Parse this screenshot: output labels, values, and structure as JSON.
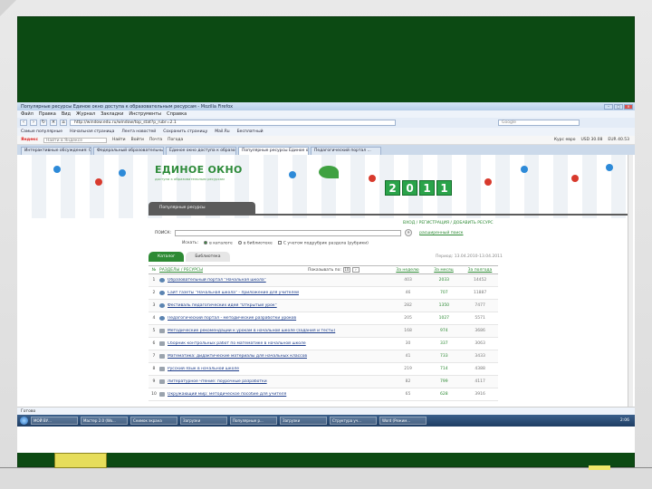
{
  "browser": {
    "title": "Популярные ресурсы Единое окно доступа к образовательным ресурсам - Mozilla Firefox",
    "menu": [
      "Файл",
      "Правка",
      "Вид",
      "Журнал",
      "Закладки",
      "Инструменты",
      "Справка"
    ],
    "url": "http://window.edu.ru/window/top_stat?p_rubr=2.1",
    "search_placeholder": "Google",
    "bookmarks": [
      "Самые популярные",
      "Начальная страница",
      "Лента новостей",
      "Сохранить страницу",
      "Mail.Ru",
      "Бесплатный"
    ],
    "toolbar": {
      "brand": "Яндекс",
      "input_placeholder": "Найти в Яндексе",
      "items": [
        "Найти",
        "Войти",
        "Почта",
        "Погода"
      ],
      "right": [
        "Курс евро",
        "USD 30.08",
        "EUR 40.53"
      ]
    },
    "tabs": [
      {
        "label": "Интерактивные обсуждения: Офи...",
        "active": false
      },
      {
        "label": "Федеральный образовательный...",
        "active": false
      },
      {
        "label": "Единое окно доступа к образоват...",
        "active": false
      },
      {
        "label": "Популярные ресурсы Единое окно...",
        "active": true
      },
      {
        "label": "Педагогический портал ...",
        "active": false
      }
    ],
    "status": "Готово"
  },
  "site": {
    "logo": "ЕДИНОЕ ОКНО",
    "logo_sub": "доступа к образовательным ресурсам",
    "year_digits": [
      "2",
      "0",
      "1",
      "1"
    ],
    "section_title": "Популярные ресурсы",
    "auth_links": "ВХОД / РЕГИСТРАЦИЯ / ДОБАВИТЬ РЕСУРС",
    "search_label": "ПОИСК:",
    "search_button": "»",
    "advanced_search": "расширенный поиск",
    "filters": [
      {
        "label": "Искать:",
        "type": "text"
      },
      {
        "label": "в каталоге",
        "type": "radio",
        "checked": true
      },
      {
        "label": "в библиотеке",
        "type": "radio",
        "checked": false
      },
      {
        "label": "С учетом подрубрик раздела (рубрики)",
        "type": "checkbox",
        "checked": false
      }
    ],
    "subtabs": [
      {
        "label": "Каталог",
        "active": true
      },
      {
        "label": "Библиотека",
        "active": false
      }
    ],
    "date_range": "Период: 13.04.2010-13.04.2011"
  },
  "table": {
    "headers": {
      "num": "№",
      "title": "РАЗДЕЛЫ / РЕСУРСЫ",
      "per_page": "Показывать по:",
      "per_page_value": "10",
      "col1": "За неделю",
      "col2": "За месяц",
      "col3": "За полгода"
    },
    "rows": [
      {
        "num": "1",
        "icon": "globe",
        "title": "Образовательный портал \"Начальная школа\"",
        "v1": "403",
        "v2": "2033",
        "v3": "14452"
      },
      {
        "num": "2",
        "icon": "globe",
        "title": "Сайт газеты \"Начальная школа\" - приложение для учителей",
        "v1": "46",
        "v2": "707",
        "v3": "11887"
      },
      {
        "num": "3",
        "icon": "globe",
        "title": "Фестиваль педагогических идей \"Открытый урок\"",
        "v1": "282",
        "v2": "1350",
        "v3": "7477"
      },
      {
        "num": "4",
        "icon": "globe",
        "title": "Педагогический портал - методические разработки уроков",
        "v1": "205",
        "v2": "1027",
        "v3": "5571"
      },
      {
        "num": "5",
        "icon": "doc",
        "title": "Методические рекомендации к урокам в начальной школе (задания и тесты)",
        "v1": "168",
        "v2": "974",
        "v3": "3686"
      },
      {
        "num": "6",
        "icon": "doc",
        "title": "Сборник контрольных работ по математике в начальной школе",
        "v1": "30",
        "v2": "337",
        "v3": "3063"
      },
      {
        "num": "7",
        "icon": "doc",
        "title": "Математика: дидактические материалы для начальных классов",
        "v1": "41",
        "v2": "733",
        "v3": "3433"
      },
      {
        "num": "8",
        "icon": "doc",
        "title": "Русский язык в начальной школе",
        "v1": "219",
        "v2": "714",
        "v3": "4388"
      },
      {
        "num": "9",
        "icon": "doc",
        "title": "Литературное чтение: поурочные разработки",
        "v1": "82",
        "v2": "799",
        "v3": "4117"
      },
      {
        "num": "10",
        "icon": "doc",
        "title": "Окружающий мир: методическое пособие для учителя",
        "v1": "65",
        "v2": "628",
        "v3": "3916"
      }
    ]
  },
  "taskbar": {
    "items": [
      "МОЙ ВУ...",
      "Мастер 2.0 (Wo...",
      "Снимок экрана",
      "Загрузки",
      "Популярные р...",
      "Загрузки",
      "Структура уч...",
      "Word (Режим..."
    ],
    "clock": "2:06"
  },
  "colors": {
    "board": "#0c4a13",
    "accent_green": "#2d8a34",
    "eraser": "#e6dd5a"
  }
}
